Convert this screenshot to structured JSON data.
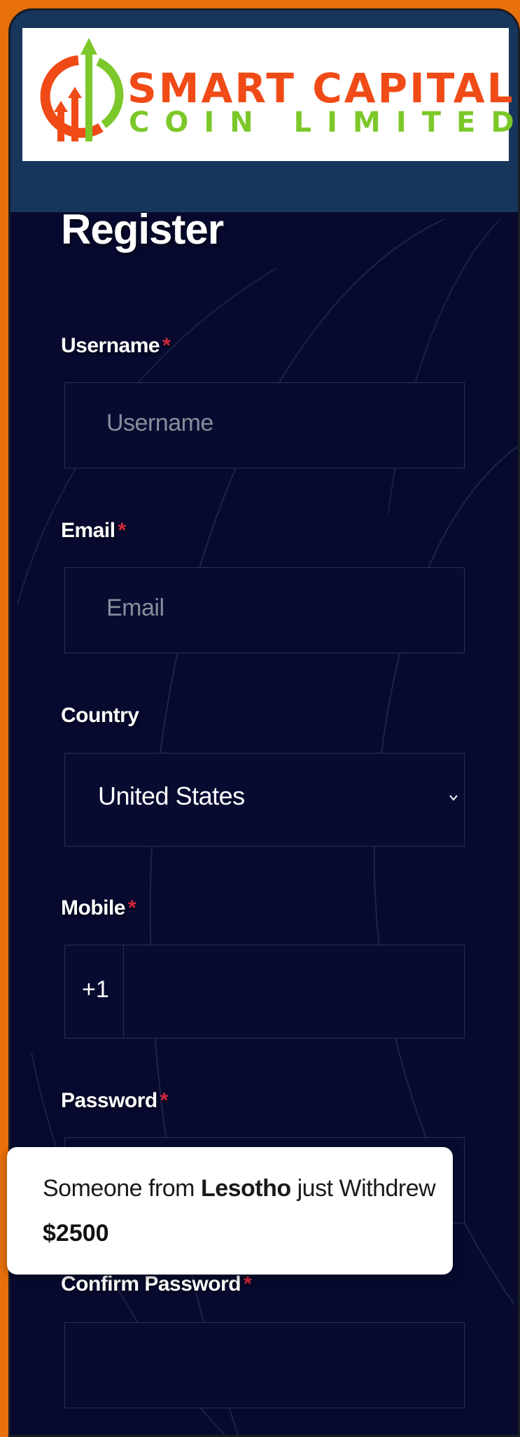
{
  "brand": {
    "name_line1": "SMART CAPITAL",
    "name_line2": "COIN LIMITED",
    "colors": {
      "orange": "#f04b17",
      "green": "#7cc82a"
    }
  },
  "page": {
    "title": "Register"
  },
  "form": {
    "username": {
      "label": "Username",
      "required": "*",
      "placeholder": "Username"
    },
    "email": {
      "label": "Email",
      "required": "*",
      "placeholder": "Email"
    },
    "country": {
      "label": "Country",
      "selected": "United States",
      "icon": "chevron-down-icon"
    },
    "mobile": {
      "label": "Mobile",
      "required": "*",
      "prefix": "+1"
    },
    "password": {
      "label": "Password",
      "required": "*"
    },
    "confirm_password": {
      "label": "Confirm Password",
      "required": "*"
    }
  },
  "toast": {
    "prefix": "Someone from",
    "country": "Lesotho",
    "action": "just Withdrew",
    "amount": "$2500"
  },
  "colors": {
    "page_bg": "#e8700a",
    "header_band": "#17365c",
    "panel_bg": "#070a2e",
    "required_mark": "#d2283c"
  }
}
